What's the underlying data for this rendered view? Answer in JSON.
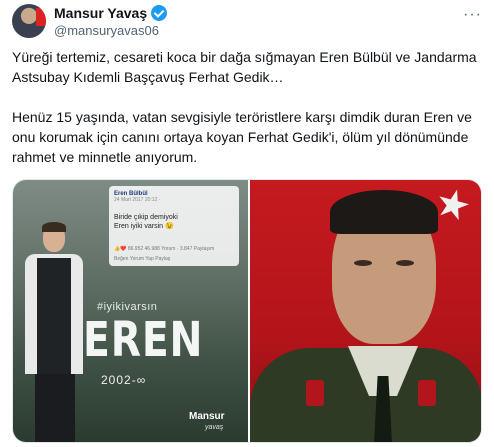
{
  "tweet": {
    "display_name": "Mansur Yavaş",
    "handle": "@mansuryavas06",
    "more_icon": "more-horizontal-icon",
    "paragraph_1": "Yüreği tertemiz, cesareti koca bir dağa sığmayan Eren Bülbül ve Jandarma Astsubay Kıdemli Başçavuş Ferhat Gedik…",
    "paragraph_2": "Henüz 15 yaşında, vatan sevgisiyle teröristlere karşı dimdik duran Eren ve onu korumak için canını ortaya koyan Ferhat Gedik'i, ölüm yıl dönümünde rahmet ve minnetle anıyorum."
  },
  "media": {
    "left_image": {
      "fb_name": "Eren Bülbül",
      "fb_date": "24 Mart 2017 20:12 · ",
      "fb_post_line_1": "Biride çıkip demiyoki",
      "fb_post_line_2": "Eren iyiki varsin 😉",
      "fb_reactions": "👍❤️ 86.952",
      "fb_counts": "46.988 Yorum · 3.847 Paylaşım",
      "fb_actions": "Beğen    Yorum Yap    Paylaş",
      "hashtag": "#iyikivarsın",
      "headline": "EREN",
      "years": "2002-∞",
      "brand": "Mansur",
      "brand_sub": "yavaş"
    }
  }
}
